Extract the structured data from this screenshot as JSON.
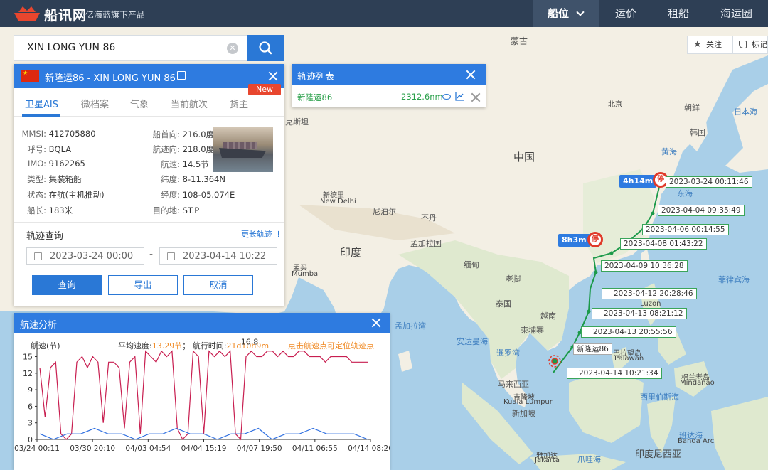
{
  "header": {
    "brand": "船讯网",
    "brand_sub": "·亿海蓝旗下产品",
    "nav": [
      {
        "label": "船位"
      },
      {
        "label": "运价"
      },
      {
        "label": "租船"
      },
      {
        "label": "海运圈"
      }
    ]
  },
  "search": {
    "value": "XIN LONG YUN 86"
  },
  "tools": {
    "follow": "关注",
    "mark": "标记"
  },
  "ship": {
    "title": "新隆运86 - XIN LONG YUN 86",
    "tabs": [
      "卫星AIS",
      "微档案",
      "气象",
      "当前航次",
      "货主"
    ],
    "new_badge": "New",
    "fields_left": [
      {
        "k": "MMSI:",
        "v": "412705880"
      },
      {
        "k": "呼号:",
        "v": "BQLA"
      },
      {
        "k": "IMO:",
        "v": "9162265"
      },
      {
        "k": "类型:",
        "v": "集装箱船"
      },
      {
        "k": "状态:",
        "v": "在航(主机推动)"
      },
      {
        "k": "船长:",
        "v": "183米"
      }
    ],
    "fields_right": [
      {
        "k": "船首向:",
        "v": "216.0度"
      },
      {
        "k": "航迹向:",
        "v": "218.0度"
      },
      {
        "k": "航速:",
        "v": "14.5节"
      },
      {
        "k": "纬度:",
        "v": "8-11.364N"
      },
      {
        "k": "经度:",
        "v": "108-05.074E"
      },
      {
        "k": "目的地:",
        "v": "ST.P"
      }
    ],
    "track_query": "轨迹查询",
    "more_tracks": "更长轨迹",
    "start_date": "2023-03-24 00:00",
    "dash": "-",
    "end_date": "2023-04-14 10:22",
    "buttons": {
      "query": "查询",
      "export": "导出",
      "cancel": "取消"
    }
  },
  "track_list": {
    "title": "轨迹列表",
    "row_name": "新隆运86",
    "row_distance": "2312.6nm"
  },
  "speed": {
    "title": "航速分析",
    "ylabel": "航速(节)",
    "avg_label": "平均速度:",
    "avg_value": "13.29节",
    "sep": "；",
    "time_label": "航行时间:",
    "time_value": "21d10h9m",
    "hint": "点击航速点可定位轨迹点",
    "max_label": "16.8"
  },
  "chart_data": {
    "type": "line",
    "ylabel": "航速(节)",
    "ylim": [
      0,
      17
    ],
    "yticks": [
      0,
      3,
      6,
      9,
      12,
      15
    ],
    "xticks": [
      "03/24 00:11",
      "03/30 20:10",
      "04/03 04:54",
      "04/04 15:19",
      "04/07 19:50",
      "04/11 06:55",
      "04/14 08:20"
    ],
    "series": [
      {
        "color": "#c81e50",
        "values": [
          13,
          4,
          13,
          14,
          1,
          0,
          1,
          14,
          15,
          13,
          15,
          14,
          3,
          14,
          14,
          13,
          2,
          14,
          15,
          1,
          16,
          15,
          14,
          16,
          15,
          16,
          2,
          0,
          1,
          16,
          15,
          1,
          16,
          15,
          16,
          15,
          16,
          1,
          0,
          15,
          16,
          15,
          15,
          16,
          16,
          15,
          16,
          15,
          15,
          16,
          16,
          15,
          15,
          15,
          14,
          15,
          15,
          15,
          15,
          14,
          14,
          14,
          14
        ]
      },
      {
        "color": "#2f6fe0",
        "values": [
          1,
          0,
          1,
          1,
          2,
          1,
          1,
          0,
          1,
          1,
          2,
          1,
          1,
          0,
          1,
          1,
          2,
          0,
          1,
          1,
          2,
          1,
          1,
          1,
          0
        ]
      }
    ],
    "max_value": 16.8
  },
  "map": {
    "labels": [
      {
        "t": "蒙古",
        "cls": "big"
      },
      {
        "t": "中国",
        "cls": "big"
      },
      {
        "t": "印度",
        "cls": "big"
      },
      {
        "t": "北京",
        "cls": "city"
      },
      {
        "t": "朝鲜",
        "cls": ""
      },
      {
        "t": "韩国",
        "cls": ""
      },
      {
        "t": "日本海",
        "cls": "sea"
      },
      {
        "t": "黄海",
        "cls": "sea"
      },
      {
        "t": "东海",
        "cls": "sea"
      },
      {
        "t": "新德里",
        "cls": "city"
      },
      {
        "t": "New Delhi",
        "cls": "city"
      },
      {
        "t": "尼泊尔",
        "cls": ""
      },
      {
        "t": "不丹",
        "cls": ""
      },
      {
        "t": "孟加拉国",
        "cls": ""
      },
      {
        "t": "缅甸",
        "cls": ""
      },
      {
        "t": "老挝",
        "cls": ""
      },
      {
        "t": "泰国",
        "cls": ""
      },
      {
        "t": "越南",
        "cls": ""
      },
      {
        "t": "柬埔寨",
        "cls": ""
      },
      {
        "t": "菲律宾海",
        "cls": "sea"
      },
      {
        "t": "孟加拉湾",
        "cls": "sea"
      },
      {
        "t": "安达曼海",
        "cls": "sea"
      },
      {
        "t": "暹罗湾",
        "cls": "sea"
      },
      {
        "t": "马来西亚",
        "cls": ""
      },
      {
        "t": "吉隆坡",
        "cls": "city"
      },
      {
        "t": "Kuala Lumpur",
        "cls": "city"
      },
      {
        "t": "新加坡",
        "cls": ""
      },
      {
        "t": "西里伯斯海",
        "cls": "sea"
      },
      {
        "t": "印度尼西亚",
        "cls": "big"
      },
      {
        "t": "雅加达",
        "cls": "city"
      },
      {
        "t": "Jakarta",
        "cls": "city"
      },
      {
        "t": "爪哇海",
        "cls": "sea"
      },
      {
        "t": "孟买",
        "cls": "city"
      },
      {
        "t": "Mumbai",
        "cls": "city"
      },
      {
        "t": "克斯坦",
        "cls": ""
      },
      {
        "t": "巴拉望岛",
        "cls": "city"
      },
      {
        "t": "Palawan",
        "cls": "city"
      },
      {
        "t": "棉兰老岛",
        "cls": "city"
      },
      {
        "t": "Mindanao",
        "cls": "city"
      },
      {
        "t": "Luzon",
        "cls": "city"
      },
      {
        "t": "Hong Kong",
        "cls": "city"
      },
      {
        "t": "班达海",
        "cls": "sea"
      },
      {
        "t": "Banda Arc",
        "cls": "city"
      },
      {
        "t": "孟加拉国",
        "cls": ""
      }
    ],
    "stop_badges": [
      {
        "t": "4h14m"
      },
      {
        "t": "8h3m"
      }
    ],
    "stop_label": "停",
    "track_labels": [
      "2023-03-24 00:11:46",
      "2023-04-04 09:35:49",
      "2023-04-06 00:14:55",
      "2023-04-08 01:43:22",
      "2023-04-09 10:36:28",
      "2023-04-12 20:28:46",
      "2023-04-13 08:21:12",
      "2023-04-13 20:55:56",
      "2023-04-14 10:21:34"
    ],
    "ship_label": "新隆运86"
  }
}
